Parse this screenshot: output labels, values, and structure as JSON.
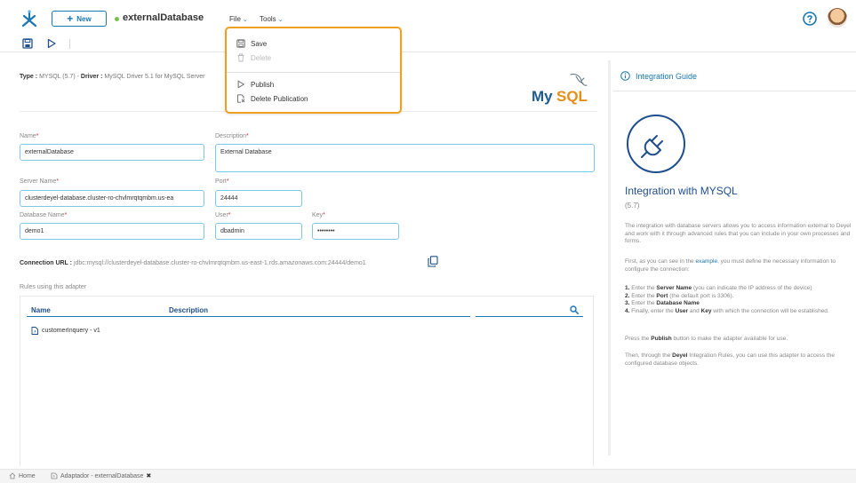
{
  "header": {
    "new_label": "New",
    "app_title": "externalDatabase",
    "menus": [
      {
        "label": "File"
      },
      {
        "label": "Tools"
      }
    ]
  },
  "file_menu": {
    "items": [
      {
        "label": "Save",
        "icon": "save-icon",
        "disabled": false
      },
      {
        "label": "Delete",
        "icon": "trash-icon",
        "disabled": true
      },
      {
        "label": "Publish",
        "icon": "play-icon",
        "disabled": false
      },
      {
        "label": "Delete Publication",
        "icon": "delete-publication-icon",
        "disabled": false
      }
    ]
  },
  "info": {
    "type_label": "Type :",
    "type_value": "MYSQL (5.7)",
    "separator": " - ",
    "driver_label": "Driver :",
    "driver_value": "MySQL Driver 5.1 for MySQL Server"
  },
  "form": {
    "name_label": "Name",
    "name_value": "externalDatabase",
    "description_label": "Description",
    "description_value": "External Database",
    "server_label": "Server Name",
    "server_value": "clusterdeyel-database.cluster-ro-chvlmrqtqmbm.us-ea",
    "port_label": "Port",
    "port_value": "24444",
    "dbname_label": "Database Name",
    "dbname_value": "demo1",
    "user_label": "User",
    "user_value": "dbadmin",
    "key_label": "Key",
    "key_value": "••••••••",
    "required_mark": "*"
  },
  "connection": {
    "label": "Connection URL :",
    "value": "jdbc:mysql://clusterdeyel-database.cluster-ro-chvlmrqtqmbm.us-east-1.rds.amazonaws.com:24444/demo1"
  },
  "rules": {
    "title": "Rules using this adapter",
    "columns": [
      "Name",
      "Description"
    ],
    "rows": [
      {
        "name": "customerInquery - v1",
        "description": ""
      }
    ]
  },
  "guide": {
    "header": "Integration Guide",
    "title": "Integration with MYSQL",
    "subtitle": "(5.7)",
    "p1": "The integration with database servers allows you to access information external to Deyel and work with it through advanced rules that you can include in your own processes and forms.",
    "p2_a": "First, as you can see in the ",
    "p2_link": "example",
    "p2_b": ", you must define the necessary information to configure the connection:",
    "steps": [
      {
        "n": "1.",
        "a": " Enter the ",
        "b": "Server Name",
        "c": " (you can indicate the IP address of the device)"
      },
      {
        "n": "2.",
        "a": " Enter the ",
        "b": "Port",
        "c": " (the default port is 3306)."
      },
      {
        "n": "3.",
        "a": " Enter the ",
        "b": "Database Name",
        "c": ""
      },
      {
        "n": "4.",
        "a": " Finally, enter the ",
        "b": "User",
        "c": " and ",
        "d": "Key",
        "e": " with which the connection will be established."
      }
    ],
    "p3_a": "Press the ",
    "p3_b": "Publish",
    "p3_c": " button to make the adapter available for use.",
    "p4_a": "Then, through the ",
    "p4_b": "Deyel",
    "p4_c": " Integration Rules, you can use this adapter to access the configured database objects."
  },
  "tabs": [
    {
      "label": "Home",
      "icon": "home-icon"
    },
    {
      "label": "Adaptador - externalDatabase",
      "icon": "adapter-icon",
      "close": "✖"
    }
  ],
  "colors": {
    "accent": "#1a77b4",
    "highlight": "#f0a020",
    "status": "#7bbf4a"
  }
}
